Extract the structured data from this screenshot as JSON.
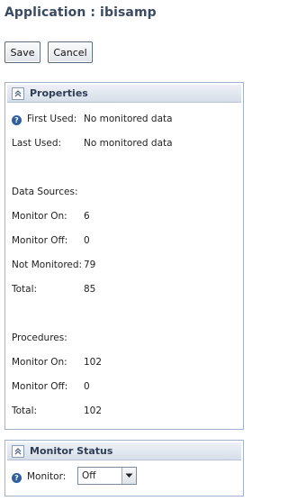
{
  "app": {
    "title": "Application : ibisamp"
  },
  "toolbar": {
    "save_label": "Save",
    "cancel_label": "Cancel"
  },
  "properties": {
    "title": "Properties",
    "first_used_label": "First Used:",
    "first_used_value": "No monitored data",
    "last_used_label": "Last Used:",
    "last_used_value": "No monitored data",
    "data_sources_heading": "Data Sources:",
    "ds_monitor_on_label": "Monitor On:",
    "ds_monitor_on_value": "6",
    "ds_monitor_off_label": "Monitor Off:",
    "ds_monitor_off_value": "0",
    "ds_not_monitored_label": "Not Monitored:",
    "ds_not_monitored_value": "79",
    "ds_total_label": "Total:",
    "ds_total_value": "85",
    "procedures_heading": "Procedures:",
    "pr_monitor_on_label": "Monitor On:",
    "pr_monitor_on_value": "102",
    "pr_monitor_off_label": "Monitor Off:",
    "pr_monitor_off_value": "0",
    "pr_total_label": "Total:",
    "pr_total_value": "102"
  },
  "monitor_status": {
    "title": "Monitor Status",
    "monitor_label": "Monitor:",
    "monitor_value": "Off"
  },
  "icons": {
    "collapse": "collapse-up-icon",
    "help": "help-icon",
    "dropdown": "chevron-down-icon"
  },
  "colors": {
    "title": "#3b4a63",
    "panel_border": "#9fb3cc",
    "help_icon": "#2e5f9e"
  }
}
